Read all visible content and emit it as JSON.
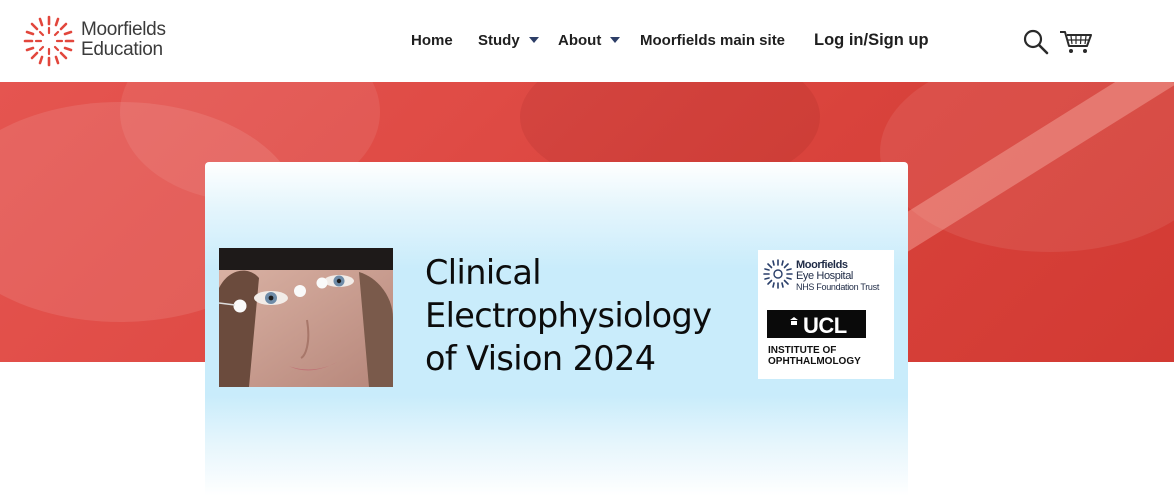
{
  "brand": {
    "line1": "Moorfields",
    "line2": "Education",
    "logo_icon": "sunburst-logo",
    "accent_color": "#e2463c"
  },
  "nav": {
    "items": [
      {
        "label": "Home"
      },
      {
        "label": "Study"
      },
      {
        "label": "About"
      },
      {
        "label": "Moorfields main site"
      },
      {
        "label": "Log in/Sign up"
      }
    ],
    "search_icon": "search-icon",
    "cart_icon": "cart-icon"
  },
  "hero": {
    "background_color": "#de4a44"
  },
  "course": {
    "title_line1": "Clinical",
    "title_line2": "Electrophysiology",
    "title_line3": "of Vision 2024",
    "card_color": "#c9ecfb"
  },
  "partners": {
    "moorfields": {
      "line1": "Moorfields",
      "line2": "Eye Hospital",
      "line3": "NHS Foundation Trust"
    },
    "ucl": {
      "wordmark": "UCL",
      "line1": "INSTITUTE OF",
      "line2": "OPHTHALMOLOGY"
    }
  }
}
